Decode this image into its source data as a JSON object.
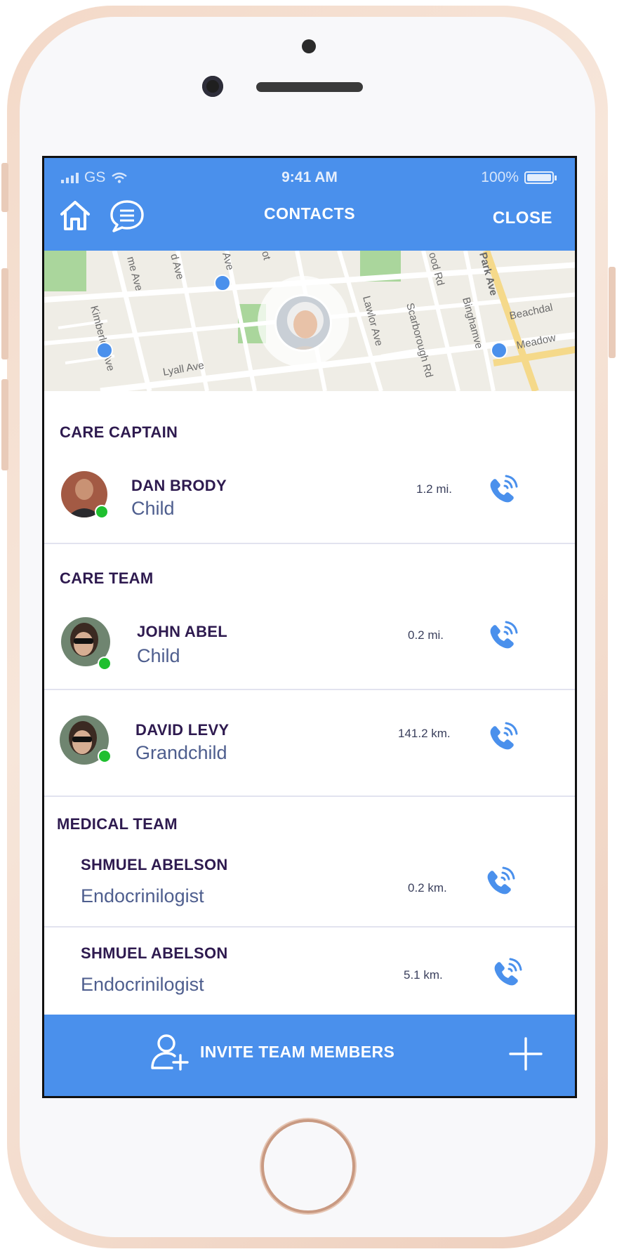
{
  "status_bar": {
    "carrier": "GS",
    "time": "9:41 AM",
    "battery": "100%"
  },
  "header": {
    "title": "CONTACTS",
    "close_label": "CLOSE",
    "icons": [
      "home-icon",
      "chat-icon"
    ]
  },
  "map": {
    "street_labels": [
      "me Ave",
      "d Ave",
      "Ave",
      "ot",
      "ood Rd",
      "Park Ave",
      "Kimberley Ave",
      "Lyall Ave",
      "Lawlor Ave",
      "Scarborough Rd",
      "Binghamve",
      "Beachdal",
      "Meadow"
    ]
  },
  "sections": {
    "care_captain": {
      "title": "CARE CAPTAIN",
      "contacts": [
        {
          "name": "DAN BRODY",
          "role": "Child",
          "distance": "1.2 mi.",
          "online": true
        }
      ]
    },
    "care_team": {
      "title": "CARE TEAM",
      "contacts": [
        {
          "name": "JOHN ABEL",
          "role": "Child",
          "distance": "0.2 mi.",
          "online": true
        },
        {
          "name": "DAVID LEVY",
          "role": "Grandchild",
          "distance": "141.2 km.",
          "online": true
        }
      ]
    },
    "medical_team": {
      "title": "MEDICAL TEAM",
      "contacts": [
        {
          "name": "SHMUEL ABELSON",
          "role": "Endocrinilogist",
          "distance": "0.2 km."
        },
        {
          "name": "SHMUEL ABELSON",
          "role": "Endocrinilogist",
          "distance": "5.1 km."
        }
      ]
    }
  },
  "footer": {
    "invite_label": "INVITE TEAM MEMBERS"
  },
  "colors": {
    "accent": "#4a90ec",
    "heading": "#2e1a4f",
    "role_text": "#4e5e8e",
    "online": "#1fbf2f"
  }
}
